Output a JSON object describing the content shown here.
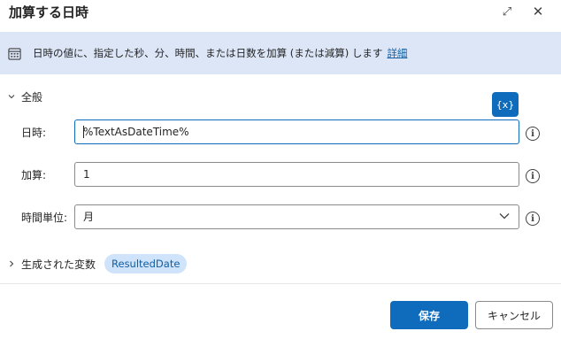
{
  "dialog": {
    "title": "加算する日時",
    "expand_icon": "expand-icon",
    "close_icon": "close-icon"
  },
  "info_bar": {
    "icon": "calendar-icon",
    "text": "日時の値に、指定した秒、分、時間、または日数を加算 (または減算) します",
    "link": "詳細"
  },
  "general_section": {
    "label": "全般",
    "expanded": true
  },
  "variable_button": {
    "label": "{x}"
  },
  "fields": {
    "datetime": {
      "label": "日時:",
      "value": "%TextAsDateTime%"
    },
    "add": {
      "label": "加算:",
      "value": "1"
    },
    "unit": {
      "label": "時間単位:",
      "value": "月"
    }
  },
  "generated_variables": {
    "label": "生成された変数",
    "chip": "ResultedDate",
    "expanded": false
  },
  "footer": {
    "save_label": "保存",
    "cancel_label": "キャンセル"
  },
  "colors": {
    "accent": "#0f6cbd",
    "info_bar_bg": "#dce6f7",
    "chip_bg": "#cfe4fa",
    "link": "#115ea3"
  }
}
